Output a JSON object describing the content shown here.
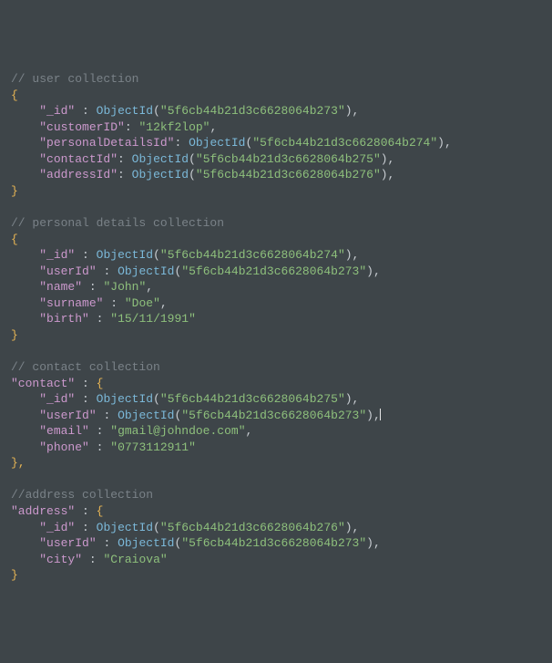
{
  "user": {
    "comment": "// user collection",
    "braceOpen": "{",
    "fields": {
      "idKey": "\"_id\"",
      "idFn": "ObjectId",
      "idVal": "\"5f6cb44b21d3c6628064b273\"",
      "customerKey": "\"customerID\"",
      "customerVal": "\"12kf2lop\"",
      "pdKey": "\"personalDetailsId\"",
      "pdFn": "ObjectId",
      "pdVal": "\"5f6cb44b21d3c6628064b274\"",
      "contactKey": "\"contactId\"",
      "contactFn": "ObjectId",
      "contactVal": "\"5f6cb44b21d3c6628064b275\"",
      "addressKey": "\"addressId\"",
      "addressFn": "ObjectId",
      "addressVal": "\"5f6cb44b21d3c6628064b276\""
    },
    "braceClose": "}"
  },
  "personal": {
    "comment": "// personal details collection",
    "braceOpen": "{",
    "fields": {
      "idKey": "\"_id\"",
      "idFn": "ObjectId",
      "idVal": "\"5f6cb44b21d3c6628064b274\"",
      "userKey": "\"userId\"",
      "userFn": "ObjectId",
      "userVal": "\"5f6cb44b21d3c6628064b273\"",
      "nameKey": "\"name\"",
      "nameVal": "\"John\"",
      "surnameKey": "\"surname\"",
      "surnameVal": "\"Doe\"",
      "birthKey": "\"birth\"",
      "birthVal": "\"15/11/1991\""
    },
    "braceClose": "}"
  },
  "contact": {
    "comment": "// contact collection",
    "rootKey": "\"contact\"",
    "braceOpen": "{",
    "fields": {
      "idKey": "\"_id\"",
      "idFn": "ObjectId",
      "idVal": "\"5f6cb44b21d3c6628064b275\"",
      "userKey": "\"userId\"",
      "userFn": "ObjectId",
      "userVal": "\"5f6cb44b21d3c6628064b273\"",
      "emailKey": "\"email\"",
      "emailVal": "\"gmail@johndoe.com\"",
      "phoneKey": "\"phone\"",
      "phoneVal": "\"0773112911\""
    },
    "braceClose": "},"
  },
  "address": {
    "comment": "//address collection",
    "rootKey": "\"address\"",
    "braceOpen": "{",
    "fields": {
      "idKey": "\"_id\"",
      "idFn": "ObjectId",
      "idVal": "\"5f6cb44b21d3c6628064b276\"",
      "userKey": "\"userId\"",
      "userFn": "ObjectId",
      "userVal": "\"5f6cb44b21d3c6628064b273\"",
      "cityKey": "\"city\"",
      "cityVal": "\"Craiova\""
    },
    "braceClose": "}"
  }
}
